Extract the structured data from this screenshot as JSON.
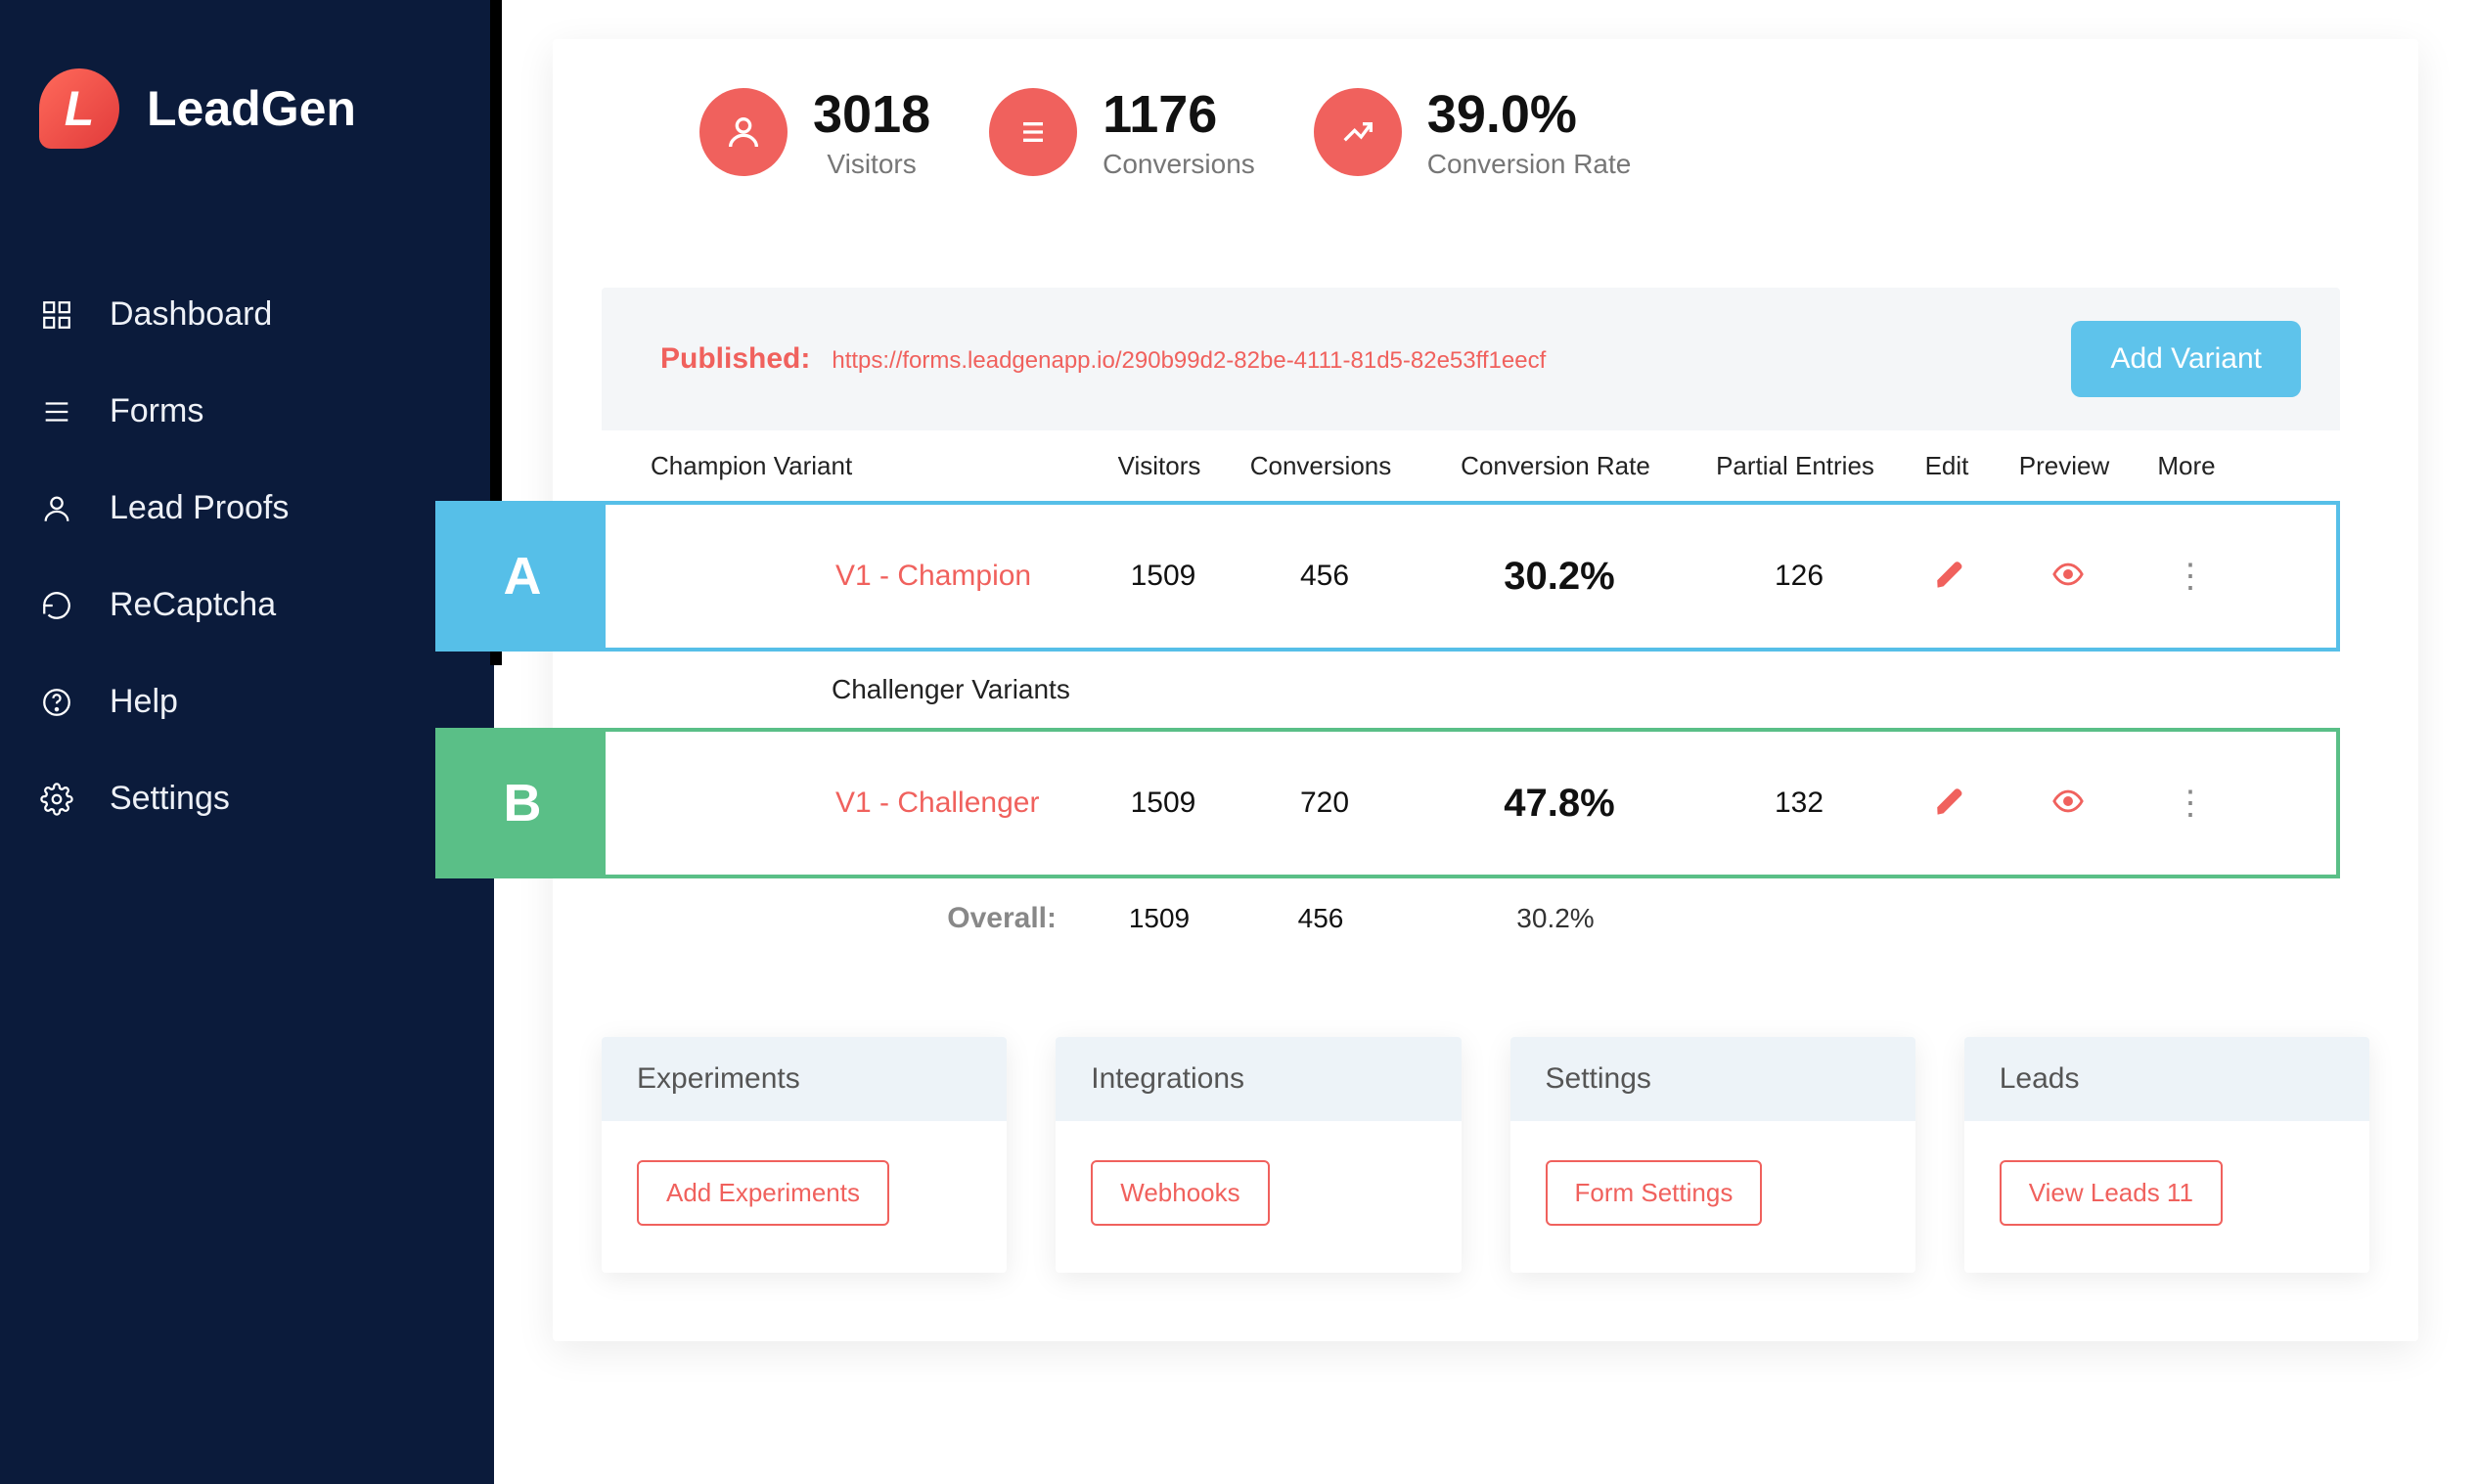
{
  "brand": {
    "logo_letter": "L",
    "name": "LeadGen"
  },
  "sidebar": {
    "items": [
      {
        "label": "Dashboard"
      },
      {
        "label": "Forms"
      },
      {
        "label": "Lead Proofs"
      },
      {
        "label": "ReCaptcha"
      },
      {
        "label": "Help"
      },
      {
        "label": "Settings"
      }
    ]
  },
  "stats": {
    "visitors": {
      "value": "3018",
      "label": "Visitors"
    },
    "conversions": {
      "value": "1176",
      "label": "Conversions"
    },
    "rate": {
      "value": "39.0%",
      "label": "Conversion Rate"
    }
  },
  "published": {
    "label": "Published:",
    "url": "https://forms.leadgenapp.io/290b99d2-82be-4111-81d5-82e53ff1eecf"
  },
  "add_variant_label": "Add Variant",
  "table": {
    "champion_header": "Champion Variant",
    "challenger_header": "Challenger Variants",
    "cols": {
      "visitors": "Visitors",
      "conversions": "Conversions",
      "rate": "Conversion Rate",
      "partial": "Partial Entries",
      "edit": "Edit",
      "preview": "Preview",
      "more": "More"
    },
    "rowA": {
      "badge": "A",
      "name": "V1 - Champion",
      "visitors": "1509",
      "conversions": "456",
      "rate": "30.2%",
      "partial": "126"
    },
    "rowB": {
      "badge": "B",
      "name": "V1 - Challenger",
      "visitors": "1509",
      "conversions": "720",
      "rate": "47.8%",
      "partial": "132"
    },
    "overall": {
      "label": "Overall:",
      "visitors": "1509",
      "conversions": "456",
      "rate": "30.2%"
    }
  },
  "footer": {
    "experiments": {
      "title": "Experiments",
      "btn": "Add  Experiments"
    },
    "integrations": {
      "title": "Integrations",
      "btn": "Webhooks"
    },
    "settings": {
      "title": "Settings",
      "btn": "Form  Settings"
    },
    "leads": {
      "title": "Leads",
      "btn": "View  Leads   11"
    }
  }
}
